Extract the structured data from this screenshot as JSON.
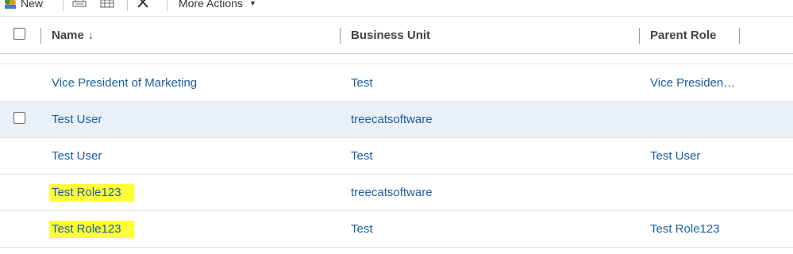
{
  "toolbar": {
    "new_label": "New",
    "more_actions_label": "More Actions",
    "icons": [
      "new-role-icon",
      "print-icon",
      "columns-icon",
      "delete-icon",
      "chevron-down-icon"
    ]
  },
  "grid": {
    "columns": [
      {
        "label": "Name",
        "sort": "descending"
      },
      {
        "label": "Business Unit"
      },
      {
        "label": "Parent Role"
      }
    ],
    "rows": [
      {
        "name": "Vice President of Marketing",
        "business_unit": "Test",
        "parent_role": "Vice Presiden…",
        "highlighted": false,
        "selected": false
      },
      {
        "name": "Test User",
        "business_unit": "treecatsoftware",
        "parent_role": "",
        "highlighted": false,
        "selected": true
      },
      {
        "name": "Test User",
        "business_unit": "Test",
        "parent_role": "Test User",
        "highlighted": false,
        "selected": false
      },
      {
        "name": "Test Role123",
        "business_unit": "treecatsoftware",
        "parent_role": "",
        "highlighted": true,
        "selected": false
      },
      {
        "name": "Test Role123",
        "business_unit": "Test",
        "parent_role": "Test Role123",
        "highlighted": true,
        "selected": false
      }
    ]
  },
  "colors": {
    "link": "#1b5ea3",
    "highlight": "#ffff33",
    "selected_row": "#e9f0f8"
  }
}
